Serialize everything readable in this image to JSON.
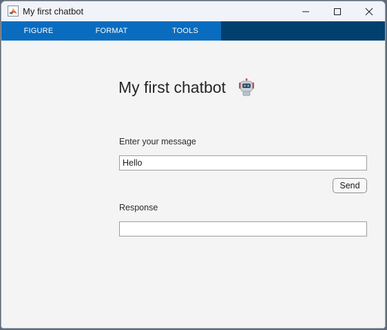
{
  "window": {
    "title": "My first chatbot",
    "app_icon": "matlab-icon"
  },
  "toolstrip": {
    "tabs": [
      {
        "label": "FIGURE"
      },
      {
        "label": "FORMAT"
      },
      {
        "label": "TOOLS"
      }
    ],
    "colors": {
      "bar": "#00406f",
      "active_section": "#0a6cbf"
    }
  },
  "main": {
    "heading": "My first chatbot",
    "heading_icon": "robot-icon",
    "message_label": "Enter your message",
    "message_value": "Hello",
    "send_label": "Send",
    "response_label": "Response",
    "response_value": ""
  }
}
